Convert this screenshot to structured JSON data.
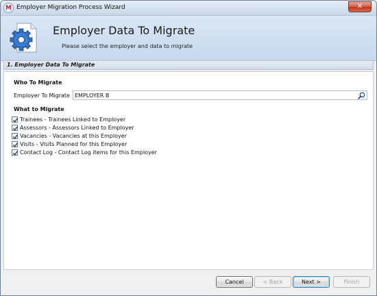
{
  "window": {
    "title": "Employer Migration Process Wizard",
    "close_glyph": "✕",
    "app_icon_letter": "M"
  },
  "banner": {
    "title": "Employer Data To Migrate",
    "subtitle": "Please select the employer and data to migrate",
    "icon": "gear-document-icon"
  },
  "step": {
    "label": "1. Employer Data To Migrate"
  },
  "who": {
    "section_title": "Who To Migrate",
    "employer_label": "Employer To Migrate",
    "employer_value": "EMPLOYER B",
    "search_icon": "search-icon"
  },
  "what": {
    "section_title": "What to Migrate",
    "items": [
      {
        "label": "Trainees - Trainees Linked to Employer",
        "checked": true
      },
      {
        "label": "Assessors - Assessors Linked to Employer",
        "checked": true
      },
      {
        "label": "Vacancies - Vacancies at this Employer",
        "checked": true
      },
      {
        "label": "Visits - Visits Planned for this Employer",
        "checked": true
      },
      {
        "label": "Contact Log - Contact Log items for this Employer",
        "checked": true
      }
    ]
  },
  "buttons": {
    "cancel": "Cancel",
    "back": "< Back",
    "next": "Next >",
    "finish": "Finish"
  },
  "colors": {
    "banner_bg": "#c7d9ee",
    "window_border": "#6d7f98",
    "close_red": "#c0391f",
    "default_button_border": "#3c7fb1"
  }
}
